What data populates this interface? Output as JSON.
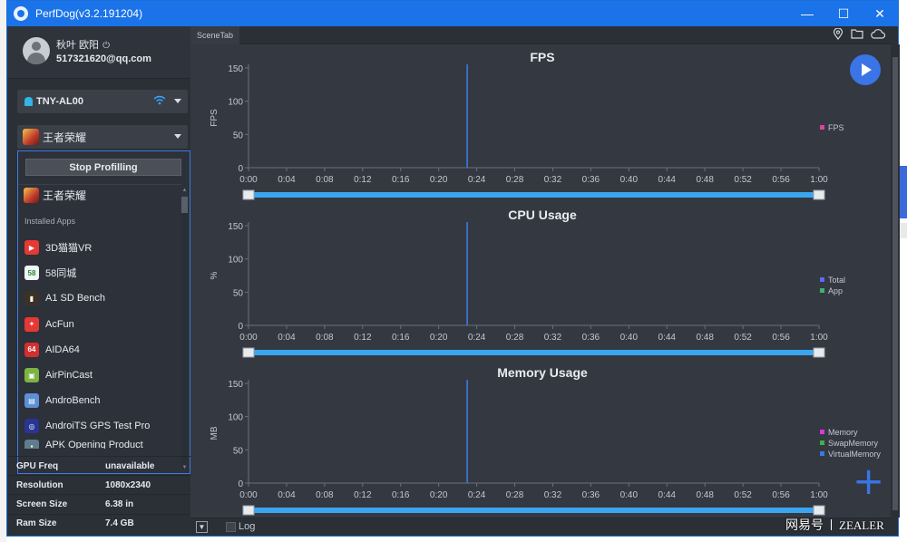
{
  "window": {
    "title": "PerfDog(v3.2.191204)"
  },
  "controls": {
    "minimize": "—",
    "maximize": "☐",
    "close": "✕"
  },
  "user": {
    "name": "秋叶 欧阳",
    "email": "517321620@qq.com"
  },
  "device": {
    "name": "TNY-AL00"
  },
  "selected_app": {
    "name": "王者荣耀"
  },
  "dropdown": {
    "stop_label": "Stop Profilling",
    "current_app": "王者荣耀",
    "section_label": "Installed Apps",
    "apps": [
      {
        "name": "3D猫猫VR",
        "icon": "vr-app-icon",
        "color": "#e53935",
        "glyph": "▶"
      },
      {
        "name": "58同城",
        "icon": "58-app-icon",
        "color": "#f4f4f4",
        "glyph": "58"
      },
      {
        "name": "A1 SD Bench",
        "icon": "sd-bench-icon",
        "color": "#3a3325",
        "glyph": "▮"
      },
      {
        "name": "AcFun",
        "icon": "acfun-icon",
        "color": "#e53935",
        "glyph": "✦"
      },
      {
        "name": "AIDA64",
        "icon": "aida64-icon",
        "color": "#d32f2f",
        "glyph": "64"
      },
      {
        "name": "AirPinCast",
        "icon": "airpincast-icon",
        "color": "#7cb342",
        "glyph": "▣"
      },
      {
        "name": "AndroBench",
        "icon": "androbench-icon",
        "color": "#5c8fd6",
        "glyph": "▤"
      },
      {
        "name": "AndroiTS GPS Test Pro",
        "icon": "gps-test-icon",
        "color": "#283593",
        "glyph": "◎"
      },
      {
        "name": "APK Opening Product",
        "icon": "apk-icon",
        "color": "#607d8b",
        "glyph": "▪"
      }
    ]
  },
  "info": [
    {
      "key": "GPU Freq",
      "value": "unavailable"
    },
    {
      "key": "Resolution",
      "value": "1080x2340"
    },
    {
      "key": "Screen Size",
      "value": "6.38 in"
    },
    {
      "key": "Ram Size",
      "value": "7.4 GB"
    }
  ],
  "tabs": {
    "scene": "SceneTab"
  },
  "log": {
    "label": "Log"
  },
  "watermark": {
    "left": "网易号",
    "right": "ZEALER"
  },
  "chart_data": [
    {
      "type": "line",
      "title": "FPS",
      "ylabel": "FPS",
      "ylim": [
        0,
        150
      ],
      "yticks": [
        "150",
        "100",
        "50",
        "0"
      ],
      "xticks": [
        "0:00",
        "0:04",
        "0:08",
        "0:12",
        "0:16",
        "0:20",
        "0:24",
        "0:28",
        "0:32",
        "0:36",
        "0:40",
        "0:44",
        "0:48",
        "0:52",
        "0:56",
        "1:00"
      ],
      "marker_time": "0:23",
      "legend": [
        {
          "name": "FPS",
          "color": "#e040a0"
        }
      ]
    },
    {
      "type": "line",
      "title": "CPU Usage",
      "ylabel": "%",
      "ylim": [
        0,
        150
      ],
      "yticks": [
        "150",
        "100",
        "50",
        "0"
      ],
      "xticks": [
        "0:00",
        "0:04",
        "0:08",
        "0:12",
        "0:16",
        "0:20",
        "0:24",
        "0:28",
        "0:32",
        "0:36",
        "0:40",
        "0:44",
        "0:48",
        "0:52",
        "0:56",
        "1:00"
      ],
      "marker_time": "0:23",
      "legend": [
        {
          "name": "Total",
          "color": "#5b6cf0"
        },
        {
          "name": "App",
          "color": "#3cb371"
        }
      ]
    },
    {
      "type": "line",
      "title": "Memory Usage",
      "ylabel": "MB",
      "ylim": [
        0,
        150
      ],
      "yticks": [
        "150",
        "100",
        "50",
        "0"
      ],
      "xticks": [
        "0:00",
        "0:04",
        "0:08",
        "0:12",
        "0:16",
        "0:20",
        "0:24",
        "0:28",
        "0:32",
        "0:36",
        "0:40",
        "0:44",
        "0:48",
        "0:52",
        "0:56",
        "1:00"
      ],
      "marker_time": "0:23",
      "legend": [
        {
          "name": "Memory",
          "color": "#d63ad6"
        },
        {
          "name": "SwapMemory",
          "color": "#39b54a"
        },
        {
          "name": "VirtualMemory",
          "color": "#3a78e6"
        }
      ]
    }
  ]
}
